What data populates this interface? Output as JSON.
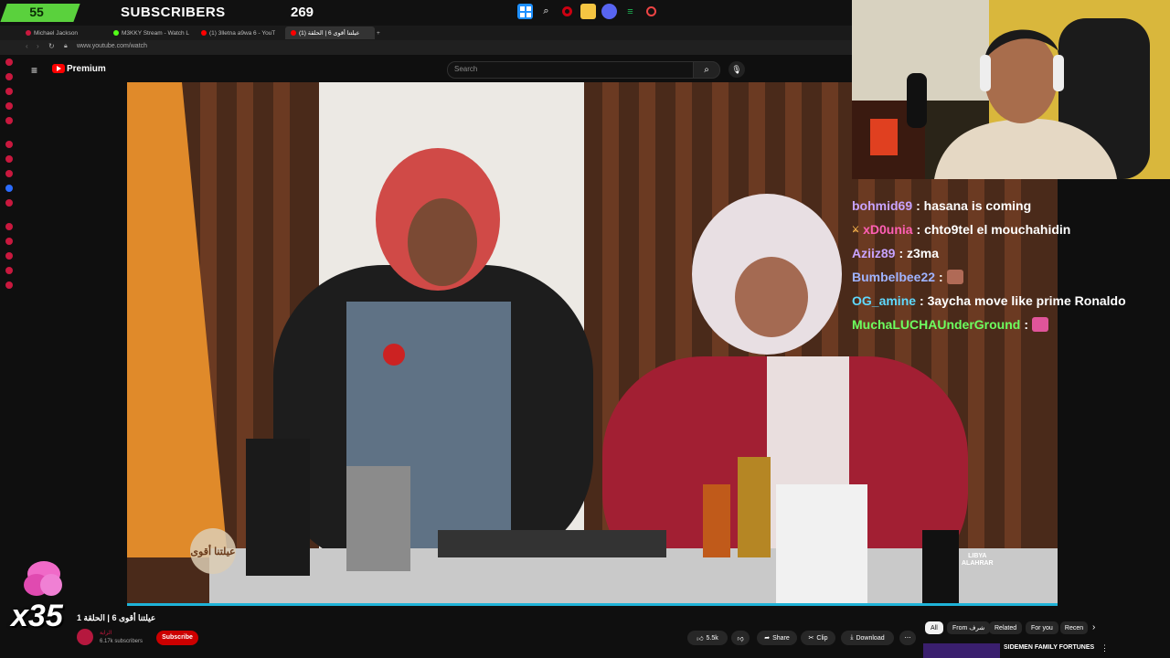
{
  "overlay": {
    "subscriber_count": "55",
    "subscriber_label": "SUBSCRIBERS",
    "subscriber_goal": "269",
    "combo": "x35"
  },
  "browser": {
    "tabs": [
      {
        "label": "Michael Jackson",
        "color": "#c9183e"
      },
      {
        "label": "M3KKY Stream - Watch L",
        "color": "#53fc18"
      },
      {
        "label": "(1) 3lletna a9wa 6 - YouT",
        "color": "#ff0000"
      },
      {
        "label": "(1) عيلتنا أقوى 6 | الحلقة",
        "color": "#ff0000"
      }
    ],
    "url": "www.youtube.com/watch"
  },
  "youtube": {
    "brand": "Premium",
    "search_placeholder": "Search",
    "video_title": "عيلتنا أقوى 6 | الحلقة 1",
    "channel_name": "الراية",
    "channel_subs": "6.17k subscribers",
    "subscribe_label": "Subscribe",
    "like_count": "5.5k",
    "share_label": "Share",
    "clip_label": "Clip",
    "download_label": "Download",
    "watermark_line1": "LIBYA",
    "watermark_line2": "ALAHRAR",
    "show_badge": "عيلتنا أقوى",
    "filter_chips": [
      "All",
      "From شرف",
      "Related",
      "For you",
      "Recen"
    ],
    "recommended_title": "SIDEMEN FAMILY FORTUNES"
  },
  "chat": [
    {
      "user": "bohmid69",
      "color": "#c8a3ff",
      "message": ": hasana is coming"
    },
    {
      "user": "xD0unia",
      "color": "#ff5fb4",
      "message": ": chto9tel el mouchahidin"
    },
    {
      "user": "Aziiz89",
      "color": "#c8a3ff",
      "message": ": z3ma"
    },
    {
      "user": "Bumbelbee22",
      "color": "#9fb3ff",
      "message": " :"
    },
    {
      "user": "OG_amine",
      "color": "#5fd9ff",
      "message": ": 3aycha move like prime Ronaldo"
    },
    {
      "user": "MuchaLUCHAUnderGround",
      "color": "#6dff5f",
      "message": " :"
    }
  ],
  "icons": [
    "menu-icon",
    "youtube-logo-icon",
    "search-icon",
    "mic-icon",
    "like-icon",
    "dislike-icon",
    "share-icon",
    "clip-icon",
    "download-icon",
    "more-icon",
    "chevron-right-icon",
    "windows-icon",
    "folder-icon",
    "discord-icon",
    "opera-icon",
    "spotify-icon"
  ]
}
